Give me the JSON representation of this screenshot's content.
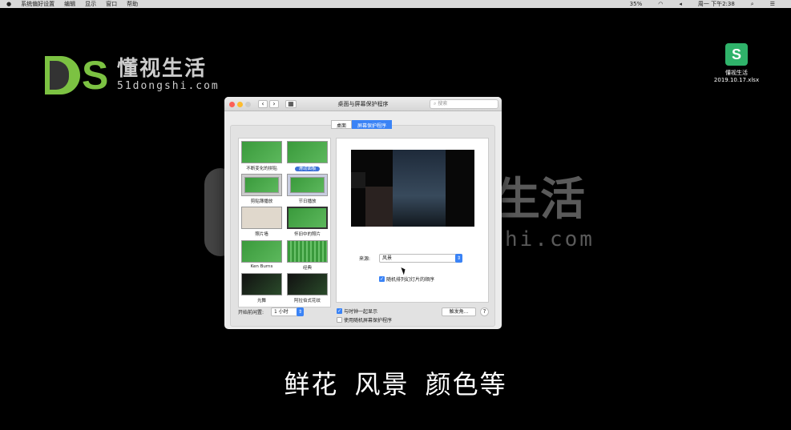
{
  "menubar": {
    "apple": "",
    "items": [
      "系统偏好设置",
      "编辑",
      "显示",
      "窗口",
      "帮助"
    ],
    "battery": "35%",
    "clock": "周一 下午2:38"
  },
  "logo": {
    "cn": "懂视生活",
    "en": "51dongshi.com"
  },
  "watermark": {
    "cn": "生活",
    "en": "hi.com"
  },
  "desktop_file": {
    "name": "懂视生活",
    "file": "2019.10.17.xlsx",
    "glyph": "S"
  },
  "window": {
    "title": "桌面与屏幕保护程序",
    "search_placeholder": "搜索",
    "tabs": [
      "桌面",
      "屏幕保护程序"
    ],
    "screensavers": [
      "不断变化的拼贴",
      "滑动面板",
      "剪贴簿播放",
      "节日播放",
      "照片墙",
      "怀旧中的照片",
      "Ken Burns",
      "经典",
      "光舞",
      "阿拉伯式花纹"
    ],
    "selected": "滑动面板",
    "source_label": "来源:",
    "source_value": "风景",
    "shuffle_label": "随机排列幻灯片的顺序",
    "idle_label": "开始前闲置:",
    "idle_value": "1 小时",
    "show_clock": "与时钟一起显示",
    "random_saver": "使用随机屏幕保护程序",
    "hot_corners": "触发角...",
    "help": "?"
  },
  "subtitle": "鲜花 风景 颜色等"
}
